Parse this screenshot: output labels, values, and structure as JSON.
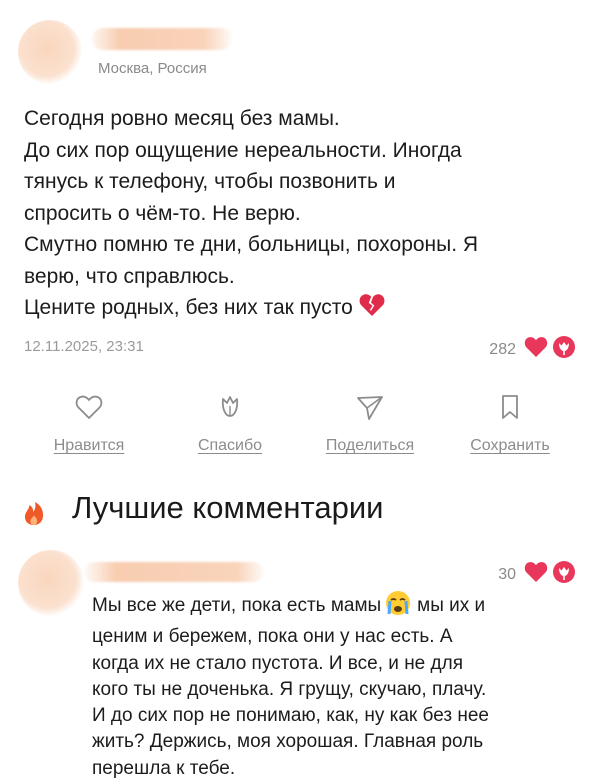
{
  "post": {
    "location": "Москва, Россия",
    "lines": [
      "Сегодня ровно месяц без мамы.",
      "До сих пор ощущение нереальности. Иногда",
      "тянусь к телефону, чтобы позвонить и",
      "спросить о чём-то. Не верю.",
      "Смутно помню те дни, больницы, похороны. Я",
      "верю, что справлюсь.",
      "Цените родных, без них так пусто"
    ],
    "date": "12.11.2025, 23:31",
    "reaction_count": "282"
  },
  "actions": {
    "like": "Нравится",
    "thanks": "Спасибо",
    "share": "Поделиться",
    "save": "Сохранить"
  },
  "best_comments": {
    "title": "Лучшие комментарии",
    "comment": {
      "reaction_count": "30",
      "lines": [
        "Мы все же дети, пока есть мамы",
        "мы их и",
        "ценим и бережем, пока они у нас есть. А",
        "когда их не стало пустота. И все, и не для",
        "кого ты не доченька. Я грущу, скучаю, плачу.",
        "И до сих пор не понимаю, как, ну как без нее",
        "жить? Держись, моя хорошая. Главная роль",
        "перешла к тебе."
      ]
    }
  },
  "colors": {
    "heart": "#e8375a",
    "fire": "#f05a28",
    "muted": "#8c8c8c"
  },
  "icons": [
    "heart-icon",
    "tulip-icon",
    "send-icon",
    "bookmark-icon",
    "fire-icon",
    "broken-heart-icon",
    "crying-face-icon"
  ]
}
